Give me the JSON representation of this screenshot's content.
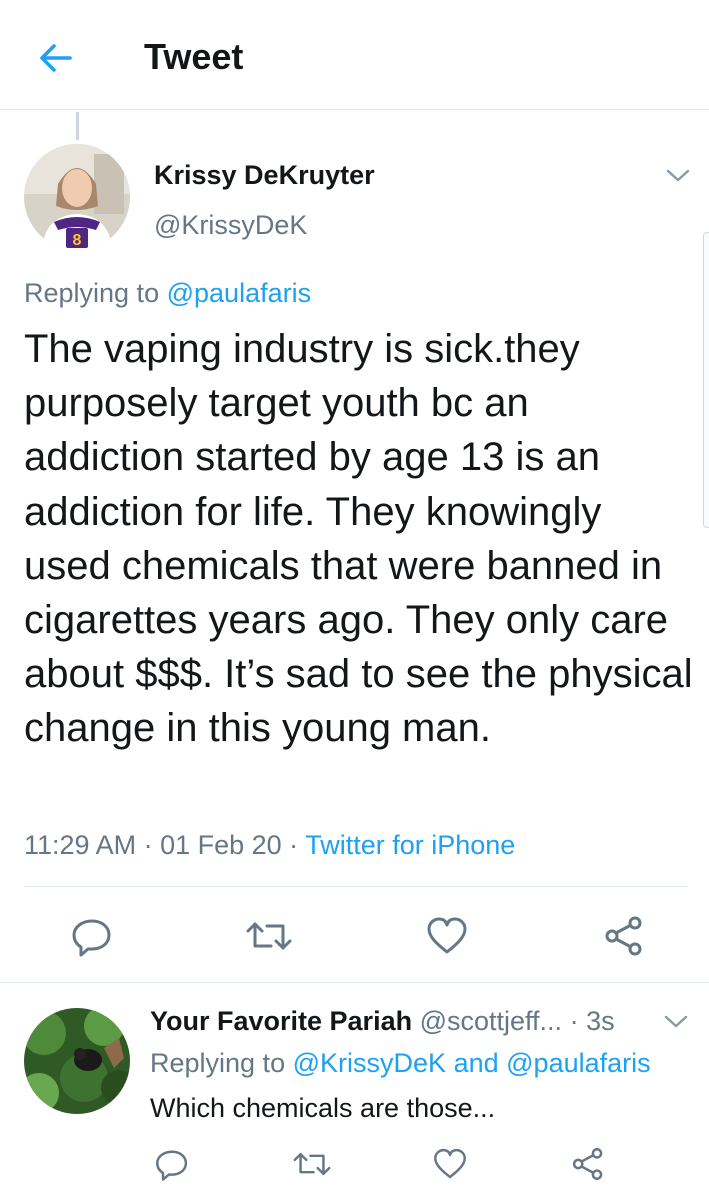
{
  "header": {
    "title": "Tweet",
    "back_icon": "arrow-left-icon",
    "accent": "#1da1f2"
  },
  "main_tweet": {
    "author_name": "Krissy DeKruyter",
    "author_handle": "@KrissyDeK",
    "replying_label": "Replying to",
    "replying_to": "@paulafaris",
    "text": "The vaping industry is sick.they purposely target youth bc an addiction started by age 13 is an addiction for life. They knowingly used chemicals that were banned in cigarettes years ago. They only care about $$$. It’s sad to see the physical change in this young man.",
    "time": "11:29 AM",
    "date": "01 Feb 20",
    "separator": " · ",
    "source": "Twitter for iPhone",
    "actions": [
      "reply-icon",
      "retweet-icon",
      "like-icon",
      "share-icon"
    ]
  },
  "reply_tweet": {
    "author_name": "Your Favorite Pariah",
    "author_handle": "@scottjeff...",
    "dot": " · ",
    "time": "3s",
    "replying_label": "Replying to",
    "replying_to_1": "@KrissyDeK",
    "and_label": "and",
    "replying_to_2": "@paulafaris",
    "text": "Which chemicals are those...",
    "actions": [
      "reply-icon",
      "retweet-icon",
      "like-icon",
      "share-icon"
    ]
  },
  "colors": {
    "text_primary": "#14171a",
    "text_secondary": "#657786",
    "link": "#1da1f2",
    "divider": "#e1e8ed"
  }
}
